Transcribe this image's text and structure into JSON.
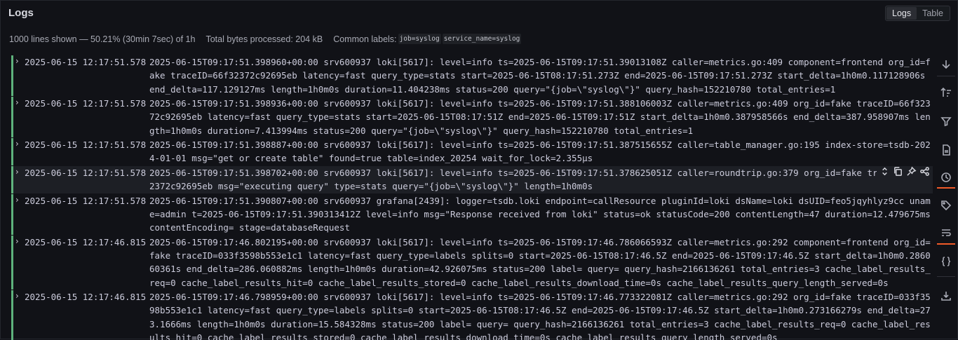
{
  "panel": {
    "title": "Logs",
    "view_toggle": {
      "logs_label": "Logs",
      "table_label": "Table",
      "active": "Logs"
    }
  },
  "meta": {
    "lines_shown": "1000 lines shown — 50.21% (30min 7sec) of 1h",
    "bytes_processed": "Total bytes processed: 204 kB",
    "common_labels_title": "Common labels:",
    "common_labels": [
      "job=syslog",
      "service_name=syslog"
    ]
  },
  "colors": {
    "level_bar": "#6ccf8e",
    "accent": "#f05a28",
    "background": "#111217"
  },
  "logs": [
    {
      "timestamp": "2025-06-15 12:17:51.578",
      "line": "2025-06-15T09:17:51.398960+00:00 srv600937 loki[5617]: level=info ts=2025-06-15T09:17:51.39013108Z caller=metrics.go:409 component=frontend org_id=fake traceID=66f32372c92695eb latency=fast query_type=stats start=2025-06-15T08:17:51.273Z end=2025-06-15T09:17:51.273Z start_delta=1h0m0.117128906s end_delta=117.129127ms length=1h0m0s duration=11.404238ms status=200 query=\"{job=\\\"syslog\\\"}\" query_hash=152210780 total_entries=1"
    },
    {
      "timestamp": "2025-06-15 12:17:51.578",
      "line": "2025-06-15T09:17:51.398936+00:00 srv600937 loki[5617]: level=info ts=2025-06-15T09:17:51.388106003Z caller=metrics.go:409 org_id=fake traceID=66f32372c92695eb latency=fast query_type=stats start=2025-06-15T08:17:51Z end=2025-06-15T09:17:51Z start_delta=1h0m0.387958566s end_delta=387.958907ms length=1h0m0s duration=7.413994ms status=200 query=\"{job=\\\"syslog\\\"}\" query_hash=152210780 total_entries=1"
    },
    {
      "timestamp": "2025-06-15 12:17:51.578",
      "line": "2025-06-15T09:17:51.398887+00:00 srv600937 loki[5617]: level=info ts=2025-06-15T09:17:51.387515655Z caller=table_manager.go:195 index-store=tsdb-2024-01-01 msg=\"get or create table\" found=true table=index_20254 wait_for_lock=2.355µs"
    },
    {
      "timestamp": "2025-06-15 12:17:51.578",
      "line": "2025-06-15T09:17:51.398702+00:00 srv600937 loki[5617]: level=info ts=2025-06-15T09:17:51.378625051Z caller=roundtrip.go:379 org_id=fake traceID=66f32372c92695eb msg=\"executing query\" type=stats query=\"{job=\\\"syslog\\\"}\" length=1h0m0s"
    },
    {
      "timestamp": "2025-06-15 12:17:51.578",
      "line": "2025-06-15T09:17:51.390807+00:00 srv600937 grafana[2439]: logger=tsdb.loki endpoint=callResource pluginId=loki dsName=loki dsUID=feo5jqyhlyz9cc uname=admin t=2025-06-15T09:17:51.390313412Z level=info msg=\"Response received from loki\" status=ok statusCode=200 contentLength=47 duration=12.479675ms contentEncoding= stage=databaseRequest"
    },
    {
      "timestamp": "2025-06-15 12:17:46.815",
      "line": "2025-06-15T09:17:46.802195+00:00 srv600937 loki[5617]: level=info ts=2025-06-15T09:17:46.786066593Z caller=metrics.go:292 component=frontend org_id=fake traceID=033f3598b553e1c1 latency=fast query_type=labels splits=0 start=2025-06-15T08:17:46.5Z end=2025-06-15T09:17:46.5Z start_delta=1h0m0.286060361s end_delta=286.060882ms length=1h0m0s duration=42.926075ms status=200 label= query= query_hash=2166136261 total_entries=3 cache_label_results_req=0 cache_label_results_hit=0 cache_label_results_stored=0 cache_label_results_download_time=0s cache_label_results_query_length_served=0s"
    },
    {
      "timestamp": "2025-06-15 12:17:46.815",
      "line": "2025-06-15T09:17:46.798959+00:00 srv600937 loki[5617]: level=info ts=2025-06-15T09:17:46.773322081Z caller=metrics.go:292 org_id=fake traceID=033f3598b553e1c1 latency=fast query_type=labels splits=0 start=2025-06-15T08:17:46.5Z end=2025-06-15T09:17:46.5Z start_delta=1h0m0.273166279s end_delta=273.1666ms length=1h0m0s duration=15.584328ms status=200 label= query= query_hash=2166136261 total_entries=3 cache_label_results_req=0 cache_label_results_hit=0 cache_label_results_stored=0 cache_label_results_download_time=0s cache_label_results_query_length_served=0s"
    }
  ],
  "sidebar": {
    "icons": [
      "scroll-to-bottom-icon",
      "sort-order-icon",
      "filter-icon",
      "download-logs-icon",
      "show-time-icon",
      "unique-labels-icon",
      "wrap-lines-icon",
      "prettify-json-icon",
      "download-icon"
    ]
  },
  "row_tools": {
    "icons": [
      "show-context-icon",
      "copy-icon",
      "pin-icon",
      "share-link-icon"
    ]
  }
}
